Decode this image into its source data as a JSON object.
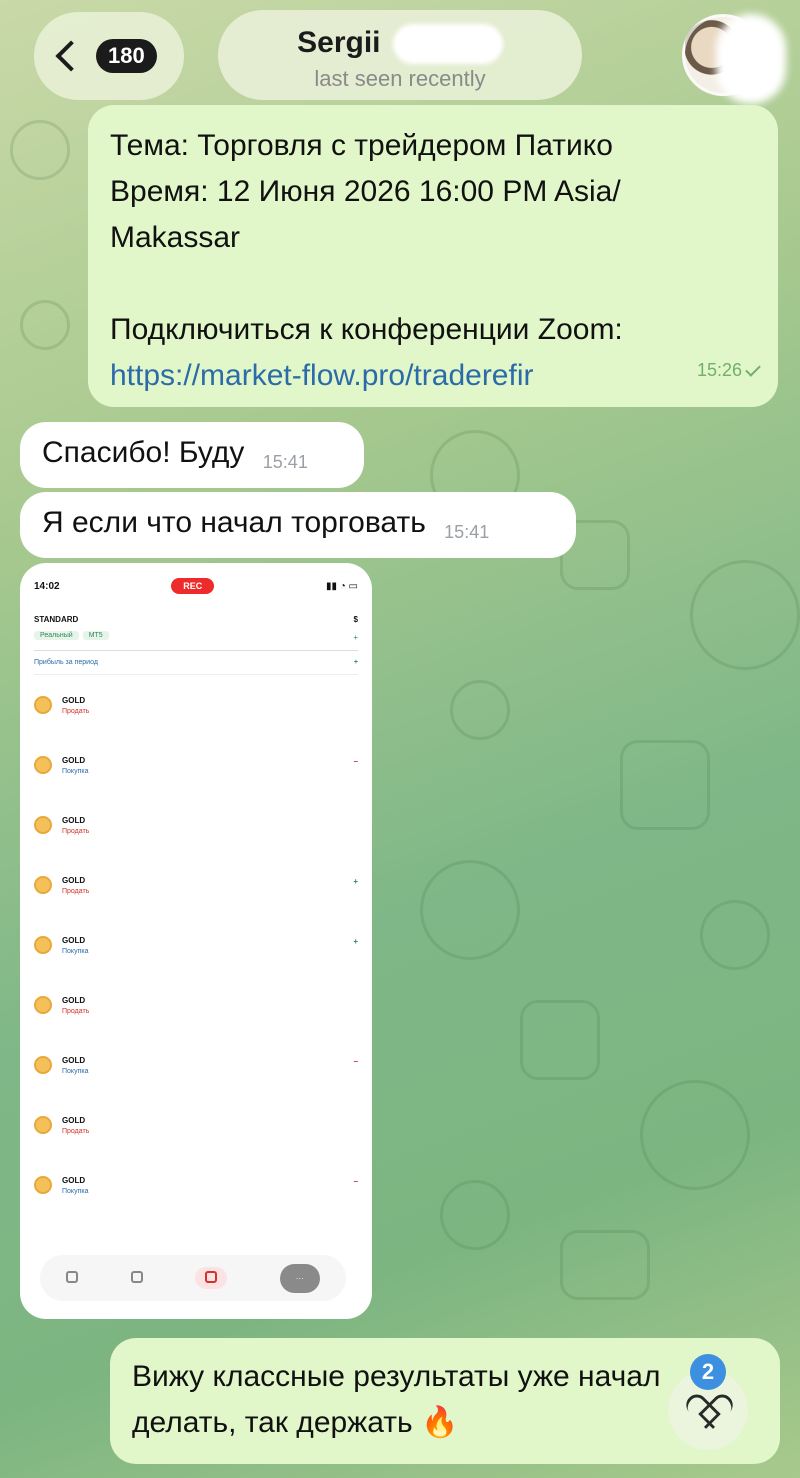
{
  "header": {
    "back_badge": "180",
    "contact_name": "Sergii",
    "contact_status": "last seen recently"
  },
  "messages": [
    {
      "direction": "outgoing",
      "lines": [
        "Тема: Торговля с трейдером Патико",
        "Время: 12 Июня  2026 16:00 PM Asia/",
        "Makassar",
        "",
        "Подключиться к конференции Zoom:"
      ],
      "link": "https://market-flow.pro/traderefir",
      "time": "15:26"
    },
    {
      "direction": "incoming",
      "text": "Спасибо! Буду",
      "time": "15:41"
    },
    {
      "direction": "incoming",
      "text": "Я если что начал торговать",
      "time": "15:41"
    },
    {
      "direction": "outgoing",
      "text_line1": "Вижу классные результаты уже начал",
      "text_line2": "делать, так держать",
      "emoji": "🔥",
      "reaction_count": "2"
    }
  ],
  "screenshot": {
    "status_time": "14:02",
    "rec_label": "REC",
    "account_name": "STANDARD",
    "account_balance": "$",
    "account_tags": [
      "Реальный",
      "MT5"
    ],
    "account_pnl": "+",
    "period_label": "Прибыль за период",
    "period_value": "+",
    "trades": [
      {
        "symbol": "GOLD",
        "side": "sell",
        "label": "Продать",
        "result": "",
        "result_sign": ""
      },
      {
        "symbol": "GOLD",
        "side": "buy",
        "label": "Покупка",
        "result": "−",
        "result_sign": "neg"
      },
      {
        "symbol": "GOLD",
        "side": "sell",
        "label": "Продать",
        "result": "",
        "result_sign": ""
      },
      {
        "symbol": "GOLD",
        "side": "sell",
        "label": "Продать",
        "result": "+",
        "result_sign": "pos"
      },
      {
        "symbol": "GOLD",
        "side": "buy",
        "label": "Покупка",
        "result": "+",
        "result_sign": "pos"
      },
      {
        "symbol": "GOLD",
        "side": "sell",
        "label": "Продать",
        "result": "",
        "result_sign": ""
      },
      {
        "symbol": "GOLD",
        "side": "buy",
        "label": "Покупка",
        "result": "−",
        "result_sign": "neg"
      },
      {
        "symbol": "GOLD",
        "side": "sell",
        "label": "Продать",
        "result": "",
        "result_sign": ""
      },
      {
        "symbol": "GOLD",
        "side": "buy",
        "label": "Покупка",
        "result": "−",
        "result_sign": "neg"
      }
    ],
    "tabs": [
      "",
      "",
      "",
      ""
    ]
  },
  "colors": {
    "outgoing_bubble": "#e1f6c9",
    "incoming_bubble": "#ffffff",
    "link": "#2b6ca8",
    "reaction_badge": "#3d8fe0"
  },
  "icons": [
    "back-chevron-icon",
    "avatar",
    "read-check-icon",
    "heart-icon",
    "gold-coin-icon"
  ]
}
